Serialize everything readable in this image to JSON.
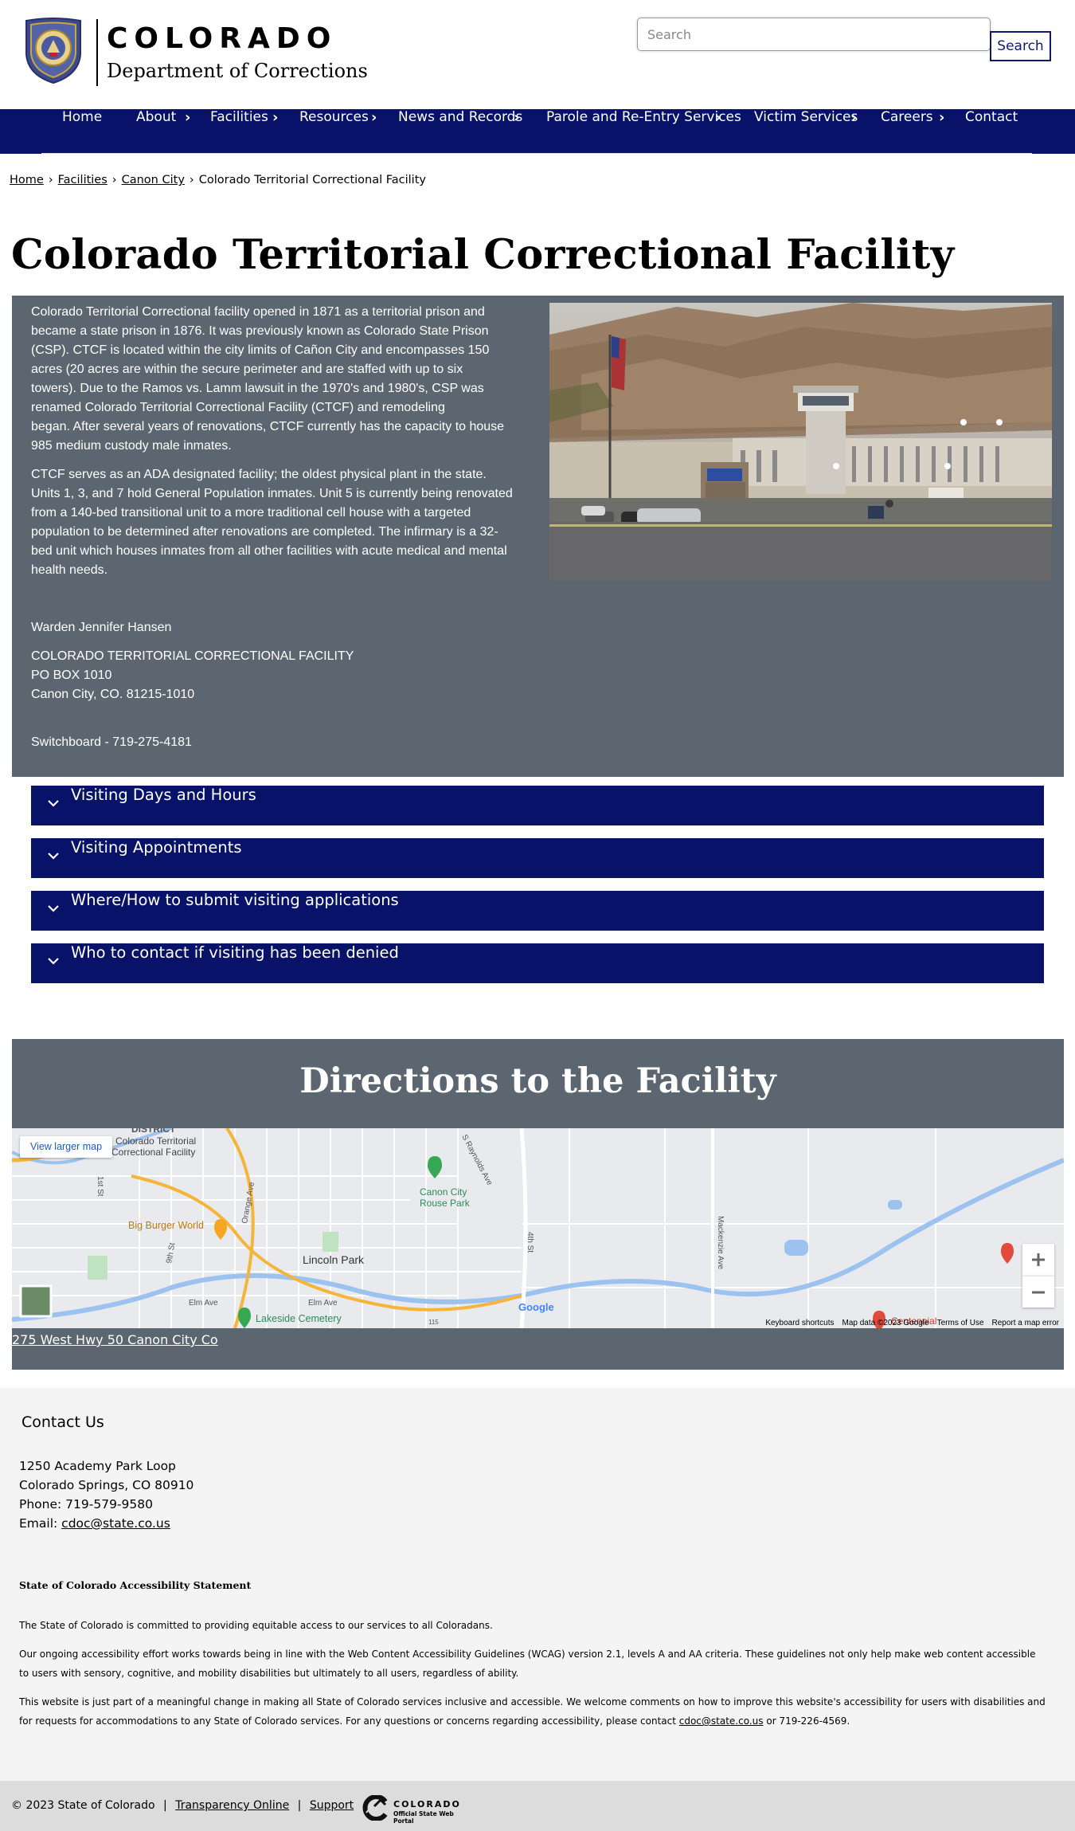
{
  "header": {
    "logo_state": "COLORADO",
    "logo_department": "Department of Corrections",
    "search_placeholder": "Search",
    "search_button": "Search"
  },
  "nav": {
    "items": [
      "Home",
      "About",
      "Facilities",
      "Resources",
      "News and Records",
      "Parole and Re-Entry Services",
      "Victim Services",
      "Careers",
      "Contact"
    ]
  },
  "breadcrumb": {
    "items": [
      "Home",
      "Facilities",
      "Canon City"
    ],
    "current": "Colorado Territorial Correctional Facility"
  },
  "page": {
    "title": "Colorado Territorial Correctional Facility"
  },
  "info": {
    "p1_lines": [
      "Colorado Territorial Correctional facility opened in 1871 as a territorial prison and",
      "became a state prison in 1876.   It was previously known as Colorado State Prison",
      "(CSP).  CTCF is located within the city limits of Cañon City and encompasses 150",
      "acres (20 acres are within the secure perimeter and are staffed with up to six",
      "towers).  Due to the Ramos vs. Lamm lawsuit in the 1970's and 1980's, CSP was",
      "renamed Colorado Territorial Correctional Facility (CTCF) and remodeling",
      "began.  After several years of renovations, CTCF currently has the capacity to house",
      "985 medium custody male inmates."
    ],
    "p2_lines": [
      "CTCF serves as an ADA designated facility; the oldest physical plant in the state.",
      "Units 1, 3, and 7 hold General Population inmates. Unit 5 is currently being renovated",
      "from a 140-bed transitional unit to a more traditional cell house with a targeted",
      "population to be determined after renovations are completed. The infirmary is a 32-",
      "bed unit which houses inmates from all other facilities with acute medical and mental",
      "health needs."
    ],
    "warden": "Warden Jennifer Hansen",
    "address_lines": [
      "COLORADO TERRITORIAL CORRECTIONAL FACILITY",
      "PO BOX 1010",
      "Canon City, CO. 81215-1010"
    ],
    "switchboard": "Switchboard - 719-275-4181"
  },
  "accordions": [
    "Visiting Days and Hours",
    "Visiting Appointments",
    "Where/How to submit visiting applications",
    "Who to contact if visiting has been denied"
  ],
  "directions": {
    "title": "Directions to the Facility",
    "view_larger_map": "View larger map",
    "map_labels": [
      "DISTRICT",
      "Colorado Territorial",
      "Correctional Facility",
      "Canon City",
      "Rouse Park",
      "Big Burger World",
      "Lincoln Park",
      "Lakeside Cemetery",
      "Elm Ave",
      "Elm Ave",
      "115",
      "Centennial",
      "1st St",
      "9th St",
      "Orange Ave",
      "4th St",
      "S Raynolds Ave",
      "Mackenzie Ave",
      "Google"
    ],
    "map_footer": [
      "Keyboard shortcuts",
      "Map data ©2023 Google",
      "Terms of Use",
      "Report a map error"
    ],
    "address_link": "275 West Hwy 50 Canon City Co"
  },
  "footer": {
    "contact_heading": "Contact Us",
    "contact_lines": [
      "1250 Academy Park Loop",
      "Colorado Springs, CO 80910",
      "Phone: 719-579-9580"
    ],
    "email_label": "Email:",
    "email": "cdoc@state.co.us",
    "a11y_heading": "State of Colorado Accessibility Statement",
    "a11y_p1": "The State of Colorado is committed to providing equitable access to our services to all Coloradans.",
    "a11y_p2": "Our ongoing accessibility effort works towards being in line with the Web Content Accessibility Guidelines (WCAG) version 2.1, levels A and AA criteria. These guidelines not only help make web content accessible to users with sensory, cognitive, and mobility disabilities but ultimately to all users, regardless of ability.",
    "a11y_p3_before": "This website is just part of a meaningful change in making all State of Colorado services inclusive and accessible. We welcome comments on how to improve this website's accessibility for users with disabilities and for requests for accommodations to any State of Colorado services. For any questions or concerns regarding accessibility, please contact ",
    "a11y_p3_email": "cdoc@state.co.us",
    "a11y_p3_after": " or 719-226-4569."
  },
  "bottom": {
    "copyright": "© 2023 State of Colorado",
    "sep": "|",
    "transparency": "Transparency Online",
    "support": "Support",
    "portal_name": "COLORADO",
    "portal_sub": "Official State Web Portal"
  },
  "colors": {
    "navy": "#071268",
    "panel_gray": "#5c6670",
    "footer_gray": "#f4f4f4",
    "bottom_bar": "#dcdcdc"
  }
}
